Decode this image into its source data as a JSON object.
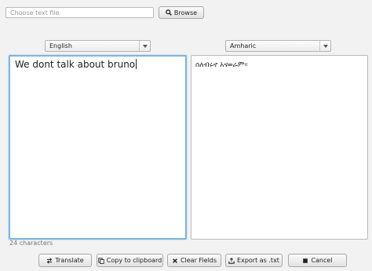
{
  "file": {
    "placeholder": "Choose text file",
    "browse_label": "Browse"
  },
  "source_language": "English",
  "target_language": "Amharic",
  "source_text": "We dont talk about bruno",
  "translated_text": "ስለብሩኖ አናወራም።",
  "char_count": "24 characters",
  "buttons": {
    "translate": "Translate",
    "copy": "Copy to clipboard",
    "clear": "Clear Fields",
    "export": "Export as .txt",
    "cancel": "Cancel"
  },
  "icons": {
    "browse": "search-icon",
    "translate": "swap-icon",
    "copy": "copy-icon",
    "clear": "close-icon",
    "export": "export-icon",
    "cancel": "stop-icon"
  },
  "colors": {
    "focus_border": "#7fb4dc",
    "background": "#f2f2f2"
  }
}
